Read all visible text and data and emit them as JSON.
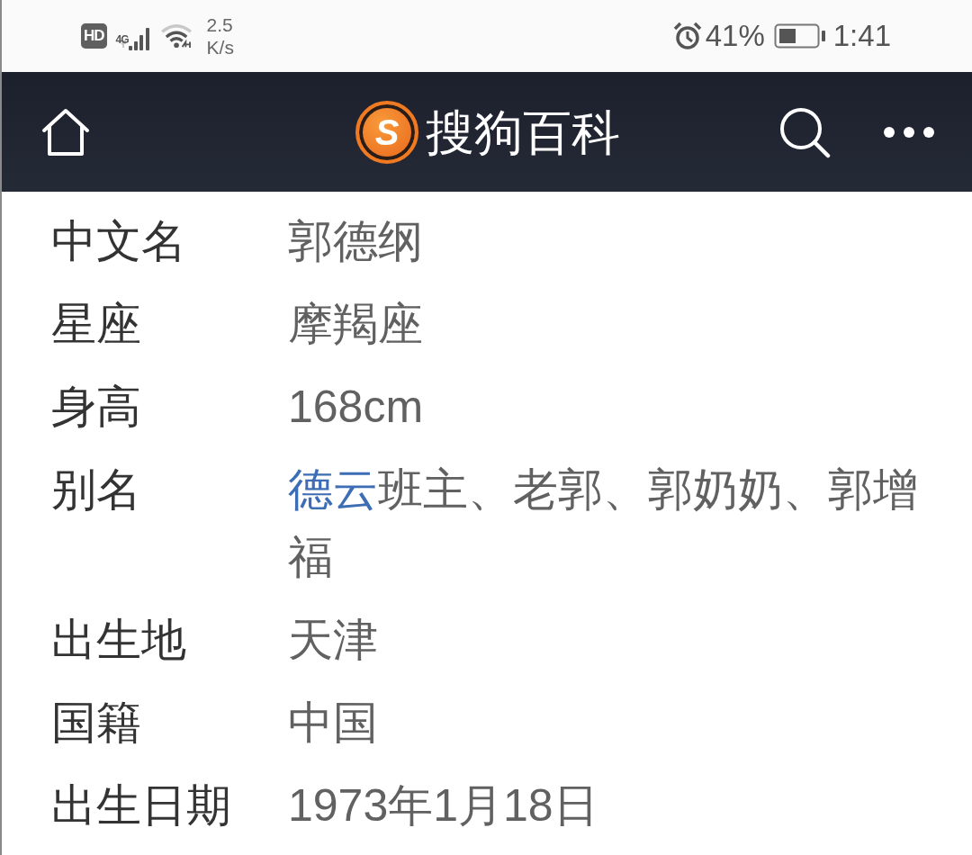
{
  "status_bar": {
    "hd_label": "HD",
    "network_type": "4G",
    "speed_value": "2.5",
    "speed_unit": "K/s",
    "battery_percent": "41%",
    "time": "1:41"
  },
  "header": {
    "logo_mark": "S",
    "title": "搜狗百科"
  },
  "info_rows": [
    {
      "label": "中文名",
      "value": [
        {
          "kind": "text",
          "text": "郭德纲"
        }
      ]
    },
    {
      "label": "星座",
      "value": [
        {
          "kind": "text",
          "text": "摩羯座"
        }
      ]
    },
    {
      "label": "身高",
      "value": [
        {
          "kind": "text",
          "text": "168cm"
        }
      ]
    },
    {
      "label": "别名",
      "value": [
        {
          "kind": "link",
          "text": "德云"
        },
        {
          "kind": "text",
          "text": "班主、老郭、郭奶奶、郭增福"
        }
      ]
    },
    {
      "label": "出生地",
      "value": [
        {
          "kind": "text",
          "text": "天津"
        }
      ]
    },
    {
      "label": "国籍",
      "value": [
        {
          "kind": "text",
          "text": "中国"
        }
      ]
    },
    {
      "label": "出生日期",
      "value": [
        {
          "kind": "text",
          "text": "1973年1月18日"
        }
      ]
    }
  ]
}
